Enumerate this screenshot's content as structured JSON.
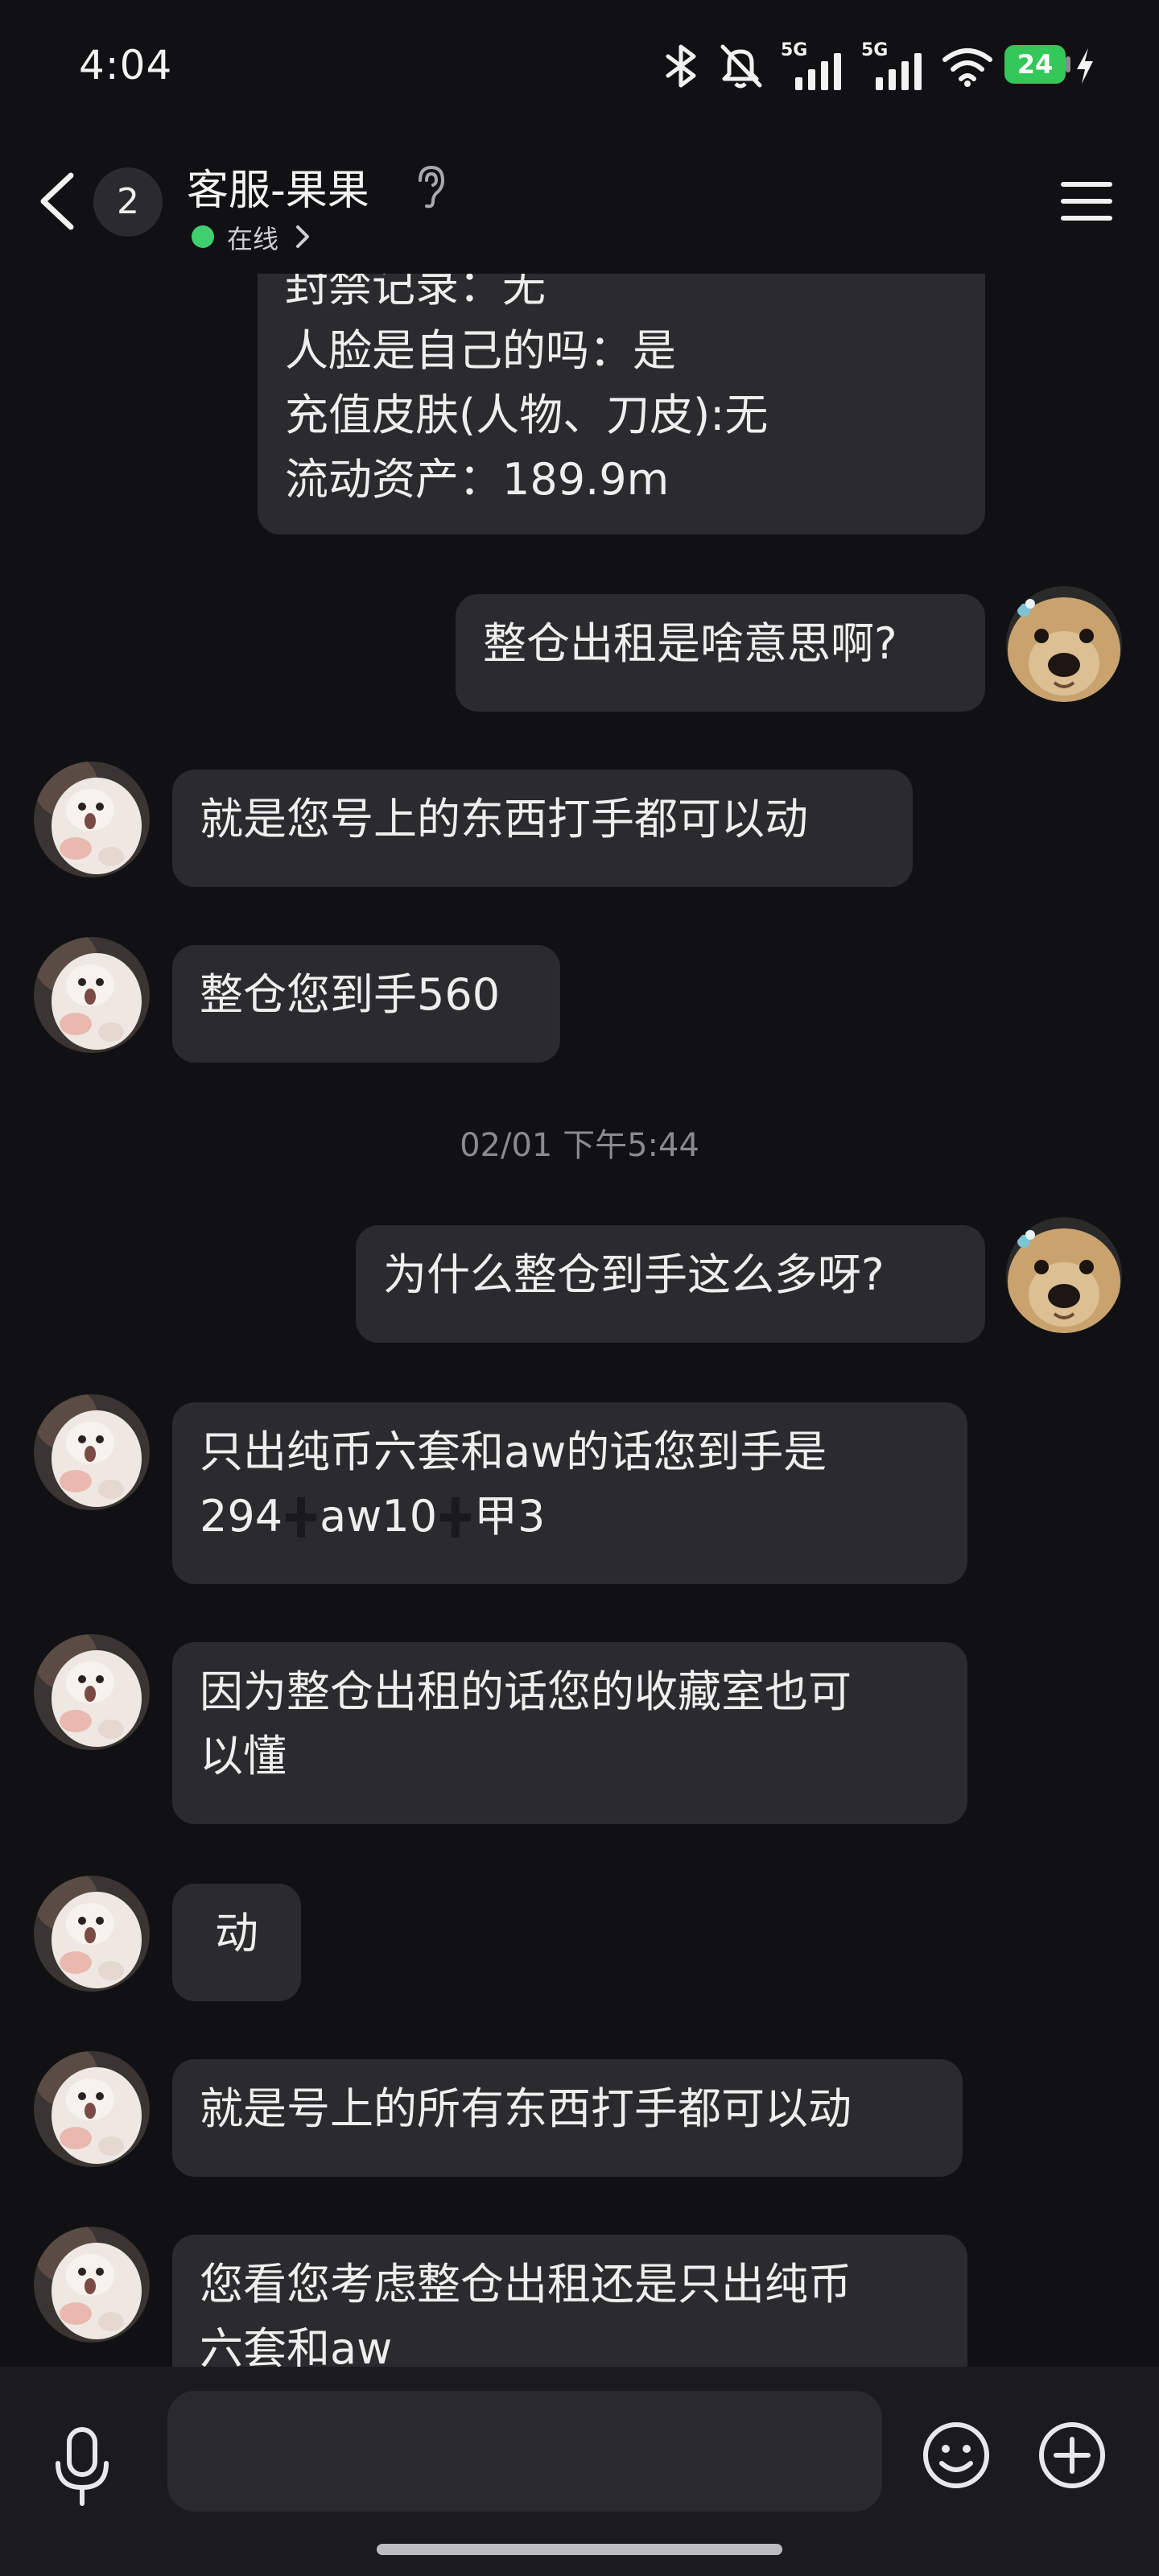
{
  "status_bar": {
    "time": "4:04",
    "battery_level": "24",
    "network_1": "5G",
    "network_2": "5G"
  },
  "header": {
    "back_badge": "2",
    "contact_name": "客服-果果",
    "presence": "在线"
  },
  "messages": [
    {
      "side": "in",
      "lines": [
        "封禁记录：无",
        "人脸是自己的吗：是",
        "充值皮肤(人物、刀皮):无",
        "流动资产：189.9m"
      ]
    },
    {
      "side": "out",
      "lines": [
        "整仓出租是啥意思啊?"
      ]
    },
    {
      "side": "in",
      "lines": [
        "就是您号上的东西打手都可以动"
      ]
    },
    {
      "side": "in",
      "lines": [
        "整仓您到手560"
      ]
    },
    {
      "type": "timestamp",
      "text": "02/01 下午5:44"
    },
    {
      "side": "out",
      "lines": [
        "为什么整仓到手这么多呀?"
      ]
    },
    {
      "side": "in",
      "lines": [
        "只出纯币六套和aw的话您到手是",
        [
          "294",
          "aw10",
          "甲3"
        ]
      ]
    },
    {
      "side": "in",
      "lines": [
        "因为整仓出租的话您的收藏室也可",
        "以懂"
      ]
    },
    {
      "side": "in",
      "lines": [
        "动"
      ]
    },
    {
      "side": "in",
      "lines": [
        "就是号上的所有东西打手都可以动"
      ]
    },
    {
      "side": "in",
      "lines": [
        "您看您考虑整仓出租还是只出纯币",
        "六套和aw"
      ]
    }
  ],
  "input": {
    "placeholder": ""
  },
  "colors": {
    "background": "#111113",
    "bubble": "#2b2b2e",
    "online": "#3ecf6e",
    "battery": "#34c759"
  },
  "icons": {
    "back": "chevron-left-icon",
    "hearing": "ear-icon",
    "menu": "hamburger-menu-icon",
    "mic": "microphone-icon",
    "emoji": "smiley-icon",
    "plus": "plus-circle-icon"
  }
}
